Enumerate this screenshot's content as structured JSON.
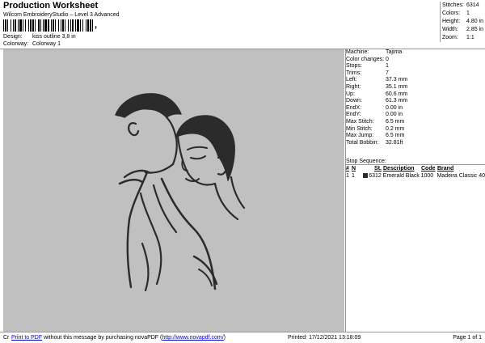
{
  "header": {
    "title": "Production Worksheet",
    "subtitle": "Wilcom EmbroideryStudio – Level 3 Advanced",
    "barcode_suffix": ","
  },
  "meta": {
    "design_label": "Design:",
    "design_value": "kiss outline 3,8 in",
    "colorway_label": "Colorway:",
    "colorway_value": "Colorway 1"
  },
  "summary": {
    "stitches_label": "Stitches:",
    "stitches_value": "6314",
    "colors_label": "Colors:",
    "colors_value": "1",
    "height_label": "Height:",
    "height_value": "4.80 in",
    "width_label": "Width:",
    "width_value": "2.85 in",
    "zoom_label": "Zoom:",
    "zoom_value": "1:1"
  },
  "machine_info": [
    {
      "label": "Machine:",
      "value": "Tajima"
    },
    {
      "label": "Color changes:",
      "value": "0"
    },
    {
      "label": "Stops:",
      "value": "1"
    },
    {
      "label": "Trims:",
      "value": "7"
    },
    {
      "label": "Left:",
      "value": "37.3 mm"
    },
    {
      "label": "Right:",
      "value": "35.1 mm"
    },
    {
      "label": "Up:",
      "value": "60.6 mm"
    },
    {
      "label": "Down:",
      "value": "61.3 mm"
    },
    {
      "label": "EndX:",
      "value": "0.00 in"
    },
    {
      "label": "EndY:",
      "value": "0.00 in"
    },
    {
      "label": "Max Stitch:",
      "value": "6.5 mm"
    },
    {
      "label": "Min Stitch:",
      "value": "0.2 mm"
    },
    {
      "label": "Max Jump:",
      "value": "6.5 mm"
    },
    {
      "label": "Total Bobbin:",
      "value": "32.81ft"
    }
  ],
  "stop_sequence": {
    "header": "Stop Sequence:",
    "columns": [
      "#",
      "N",
      "St.",
      "Description",
      "Code",
      "Brand"
    ],
    "rows": [
      {
        "num": "1",
        "needle": "1",
        "stitches": "6312",
        "description": "Emerald Black",
        "code": "1000",
        "brand": "Madeira Classic 40",
        "swatch_color": "#2b2b2b"
      }
    ]
  },
  "footer": {
    "cr": "Cr",
    "print_link": "Print to PDF",
    "promo_text": " without this message by purchasing novaPDF (",
    "url_link": "http://www.novapdf.com/",
    "promo_end": ")",
    "printed": "Printed: 17/12/2021 13:18:09",
    "page": "Page 1 of 1"
  },
  "colors": {
    "canvas_bg": "#c0c0c0",
    "stitch": "#2b2b2b",
    "link": "#0000cc"
  }
}
